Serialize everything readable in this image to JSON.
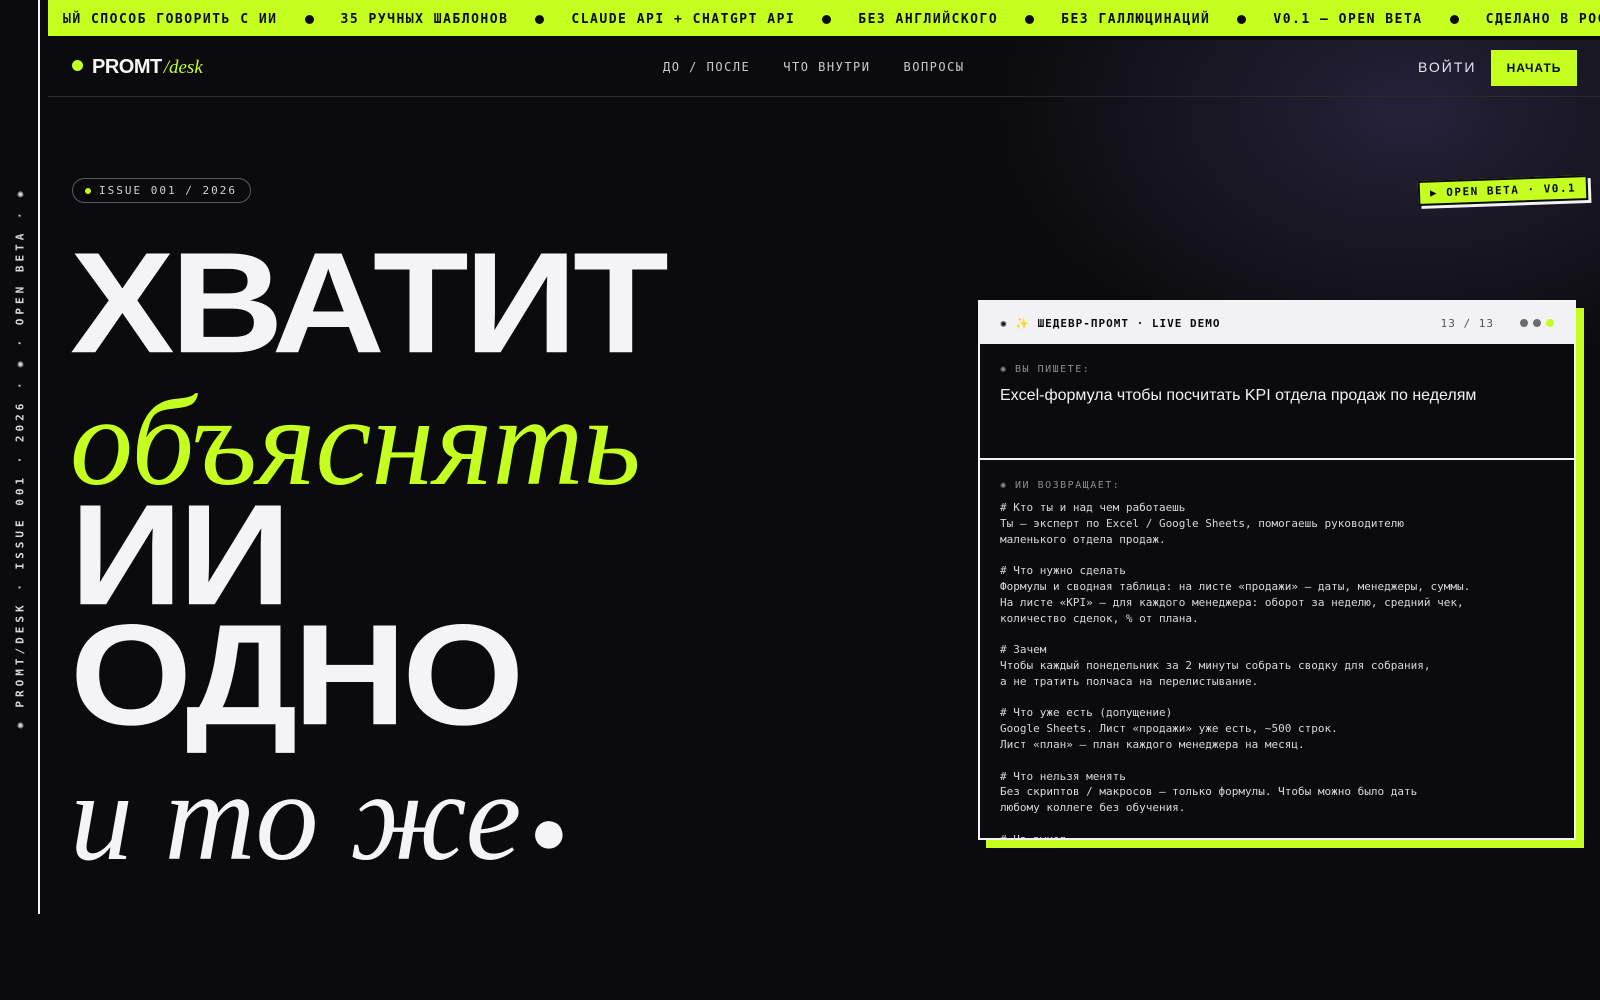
{
  "ticker": {
    "items": [
      "ЫЙ СПОСОБ ГОВОРИТЬ С ИИ",
      "35 РУЧНЫХ ШАБЛОНОВ",
      "CLAUDE API + CHATGPT API",
      "БЕЗ АНГЛИЙСКОГО",
      "БЕЗ ГАЛЛЮЦИНАЦИЙ",
      "V0.1 — OPEN BETA",
      "СДЕЛАНО В РОССИИ",
      "СД"
    ]
  },
  "rail": {
    "text": "✺ PROMT/DESK · ISSUE 001 · 2026 · ✺ · OPEN BETA · ✺"
  },
  "header": {
    "logo_main": "PROMT",
    "logo_sub": "/desk",
    "nav": [
      "ДО / ПОСЛЕ",
      "ЧТО ВНУТРИ",
      "ВОПРОСЫ"
    ],
    "login": "ВОЙТИ",
    "start": "НАЧАТЬ"
  },
  "hero": {
    "issue": "ISSUE 001 / 2026",
    "lines": [
      "ХВАТИТ",
      "объяснять",
      "ИИ",
      "ОДНО",
      "и то же"
    ],
    "end_dot": "●",
    "beta_badge": "▶ OPEN BETA · V0.1"
  },
  "demo": {
    "title": "✺ ✨ ШЕДЕВР-ПРОМТ · LIVE DEMO",
    "counter": "13 / 13",
    "input_label": "✺ ВЫ ПИШЕТЕ:",
    "input_text": "Excel-формула чтобы посчитать KPI отдела продаж по неделям",
    "output_label": "✺ ИИ ВОЗВРАЩАЕТ:",
    "output_lines": [
      "# Кто ты и над чем работаешь",
      "Ты — эксперт по Excel / Google Sheets, помогаешь руководителю",
      "маленького отдела продаж.",
      "",
      "# Что нужно сделать",
      "Формулы и сводная таблица: на листе «продажи» — даты, менеджеры, суммы.",
      "На листе «KPI» — для каждого менеджера: оборот за неделю, средний чек,",
      "количество сделок, % от плана.",
      "",
      "# Зачем",
      "Чтобы каждый понедельник за 2 минуты собрать сводку для собрания,",
      "а не тратить полчаса на перелистывание.",
      "",
      "# Что уже есть (допущение)",
      "Google Sheets. Лист «продажи» уже есть, ~500 строк.",
      "Лист «план» — план каждого менеджера на месяц.",
      "",
      "# Что нельзя менять",
      "Без скриптов / макросов — только формулы. Чтобы можно было дать",
      "любому коллеге без обучения.",
      "",
      "# На выход"
    ]
  },
  "colors": {
    "accent": "#c5ff1f",
    "background": "#0b0b0d",
    "text": "#f2f2f4"
  }
}
